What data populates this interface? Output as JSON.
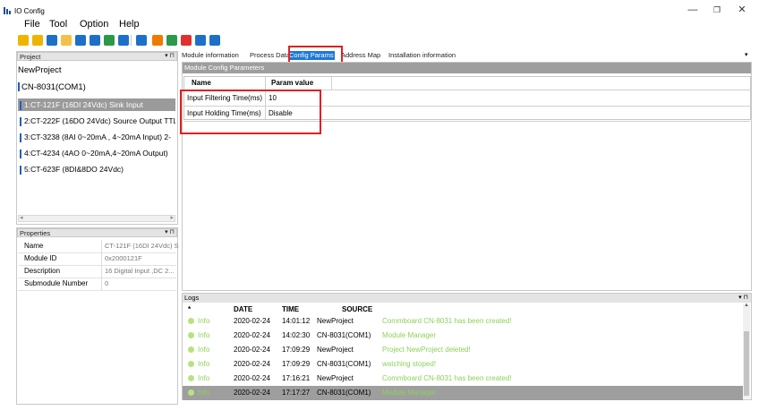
{
  "window": {
    "title": "IO Config",
    "controls": [
      "—",
      "❐",
      "✕"
    ]
  },
  "menu": [
    "File",
    "Tool",
    "Option",
    "Help"
  ],
  "toolbar": {
    "icons": [
      {
        "name": "new-icon",
        "color": "#f0b400"
      },
      {
        "name": "open-folder-icon",
        "color": "#f0b400"
      },
      {
        "name": "save-icon",
        "color": "#1e6fc8"
      },
      {
        "name": "import-icon",
        "color": "#f5c04a"
      },
      {
        "name": "search-icon",
        "color": "#1e6fc8"
      },
      {
        "name": "module-icon",
        "color": "#1e6fc8"
      },
      {
        "name": "device-icon",
        "color": "#2a9a4a"
      },
      {
        "name": "info-icon",
        "color": "#1e6fc8"
      },
      {
        "name": "compile-icon",
        "color": "#1e6fc8"
      },
      {
        "name": "download-icon",
        "color": "#f07a00"
      },
      {
        "name": "upload-icon",
        "color": "#2a9a4a"
      },
      {
        "name": "delete-icon",
        "color": "#e03030"
      },
      {
        "name": "connect-icon",
        "color": "#1e6fc8"
      },
      {
        "name": "window-icon",
        "color": "#1e6fc8"
      }
    ]
  },
  "project": {
    "header": "Project",
    "pin": "▾ ⊓",
    "root": "NewProject",
    "controller": "CN-8031(COM1)",
    "modules": [
      "1:CT-121F (16DI 24Vdc) Sink Input",
      "2:CT-222F (16DO 24Vdc) Source Output TTL",
      "3:CT-3238 (8AI 0~20mA , 4~20mA Input) 2-",
      "4:CT-4234 (4AO 0~20mA,4~20mA Output)",
      "5:CT-623F (8DI&8DO 24Vdc)"
    ],
    "selected_index": 0
  },
  "properties": {
    "header": "Properties",
    "pin": "▾ ⊓",
    "rows": [
      {
        "label": "Name",
        "value": "CT-121F (16DI 24Vdc) S"
      },
      {
        "label": "Module ID",
        "value": "0x2000121F"
      },
      {
        "label": "Description",
        "value": "16 Digital Input ,DC 2..."
      },
      {
        "label": "Submodule Number",
        "value": "0"
      }
    ]
  },
  "tabs": {
    "items": [
      "Module information",
      "Process Data",
      "Config Params",
      "Address Map",
      "Installation information"
    ],
    "active": "Config Params",
    "collapse": "▾"
  },
  "config": {
    "header": "Module Config Parameters",
    "columns": [
      "Name",
      "Param value"
    ],
    "rows": [
      {
        "name": "Input Filtering Time(ms)",
        "value": "10"
      },
      {
        "name": "Input Holding Time(ms)",
        "value": "Disable"
      }
    ]
  },
  "logs": {
    "header": "Logs",
    "pin": "▾ ⊓",
    "columns": [
      "*",
      "DATE",
      "TIME",
      "SOURCE"
    ],
    "rows": [
      {
        "level": "Info",
        "date": "2020-02-24",
        "time": "14:01:12",
        "source": "NewProject",
        "message": "Commboard CN-8031 has been created!"
      },
      {
        "level": "Info",
        "date": "2020-02-24",
        "time": "14:02:30",
        "source": "CN-8031(COM1)",
        "message": "Module Manager"
      },
      {
        "level": "Info",
        "date": "2020-02-24",
        "time": "17:09:29",
        "source": "NewProject",
        "message": "Project NewProject deleted!"
      },
      {
        "level": "Info",
        "date": "2020-02-24",
        "time": "17:09:29",
        "source": "CN-8031(COM1)",
        "message": "watching stoped!"
      },
      {
        "level": "Info",
        "date": "2020-02-24",
        "time": "17:16:21",
        "source": "NewProject",
        "message": "Commboard CN-8031 has been created!"
      },
      {
        "level": "Info",
        "date": "2020-02-24",
        "time": "17:17:27",
        "source": "CN-8031(COM1)",
        "message": "Module Manager"
      }
    ],
    "selected_index": 5
  }
}
